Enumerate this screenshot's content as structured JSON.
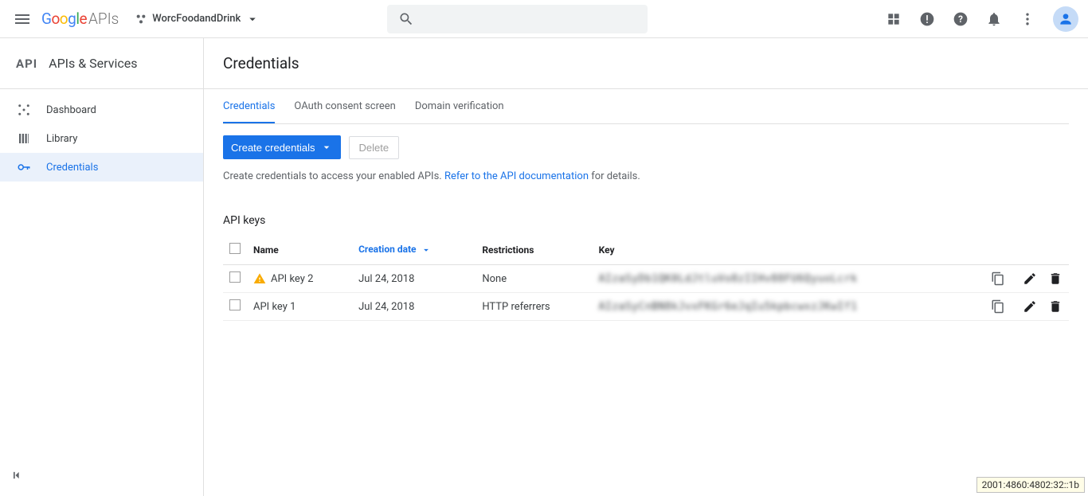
{
  "topbar": {
    "logo_apis": "APIs",
    "project_name": "WorcFoodandDrink"
  },
  "sidebar": {
    "section_title": "APIs & Services",
    "items": [
      {
        "label": "Dashboard"
      },
      {
        "label": "Library"
      },
      {
        "label": "Credentials"
      }
    ]
  },
  "page": {
    "title": "Credentials"
  },
  "tabs": [
    {
      "label": "Credentials"
    },
    {
      "label": "OAuth consent screen"
    },
    {
      "label": "Domain verification"
    }
  ],
  "actions": {
    "create": "Create credentials",
    "delete": "Delete"
  },
  "help": {
    "pre": "Create credentials to access your enabled APIs. ",
    "link": "Refer to the API documentation",
    "post": " for details."
  },
  "api_keys": {
    "title": "API keys",
    "headers": {
      "name": "Name",
      "creation": "Creation date",
      "restrictions": "Restrictions",
      "key": "Key"
    },
    "rows": [
      {
        "name": "API key 2",
        "creation": "Jul 24, 2018",
        "restrictions": "None",
        "key": "AIzaSyDb1QK0LdJtluVo8zIIHv88FU6QyuoLcrk",
        "warn": true
      },
      {
        "name": "API key 1",
        "creation": "Jul 24, 2018",
        "restrictions": "HTTP referrers",
        "key": "AIzaSyCnBN8kJvxFKGr6eJqIu5kpbcwxzJKwIf1",
        "warn": false
      }
    ]
  },
  "footer": {
    "ip": "2001:4860:4802:32::1b"
  }
}
